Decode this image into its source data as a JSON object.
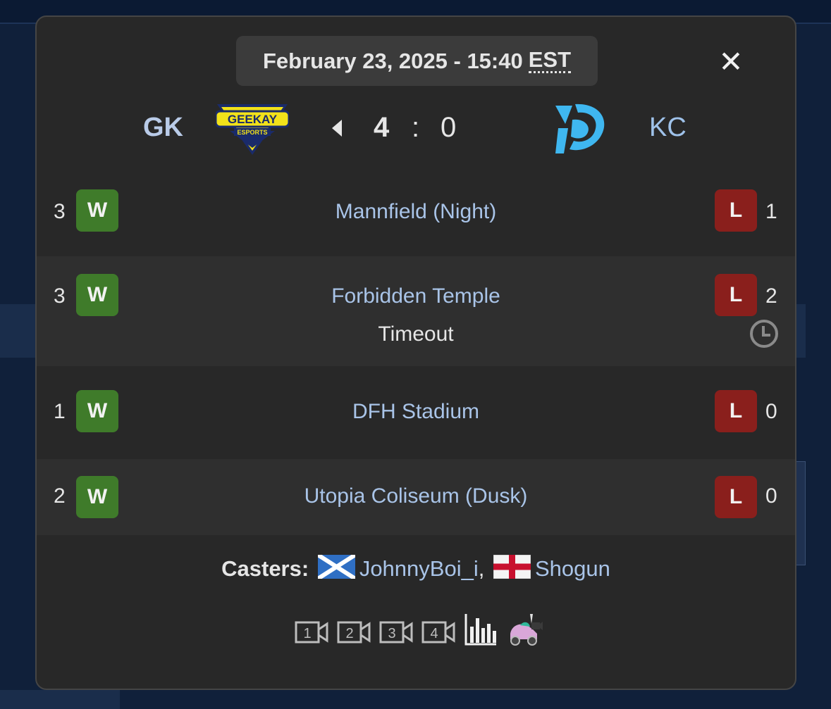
{
  "match": {
    "date": "February 23, 2025 - 15:40",
    "timezone": "EST",
    "close_symbol": "✕",
    "team_a": {
      "abbr": "GK",
      "logo_text": "GEEKAY",
      "logo_subtext": "ESPORTS"
    },
    "team_b": {
      "abbr": "KC"
    },
    "score_a": "4",
    "score_separator": ":",
    "score_b": "0"
  },
  "games": [
    {
      "score_a": "3",
      "result_a": "W",
      "map": "Mannfield (Night)",
      "result_b": "L",
      "score_b": "1"
    },
    {
      "score_a": "3",
      "result_a": "W",
      "map": "Forbidden Temple",
      "note": "Timeout",
      "result_b": "L",
      "score_b": "2"
    },
    {
      "score_a": "1",
      "result_a": "W",
      "map": "DFH Stadium",
      "result_b": "L",
      "score_b": "0"
    },
    {
      "score_a": "2",
      "result_a": "W",
      "map": "Utopia Coliseum (Dusk)",
      "result_b": "L",
      "score_b": "0"
    }
  ],
  "casters": {
    "label": "Casters:",
    "list": [
      {
        "flag": "scotland",
        "name": "JohnnyBoi_i",
        "sep": ","
      },
      {
        "flag": "england",
        "name": "Shogun"
      }
    ]
  },
  "media": {
    "vod_icons": [
      "1",
      "2",
      "3",
      "4"
    ],
    "stats_icon": "bar-chart-icon",
    "replay_icon": "car-camera-icon"
  },
  "colors": {
    "win": "#3f7b2a",
    "loss": "#8a1f1c",
    "link": "#a9c4e8",
    "modal_bg": "#282828"
  }
}
